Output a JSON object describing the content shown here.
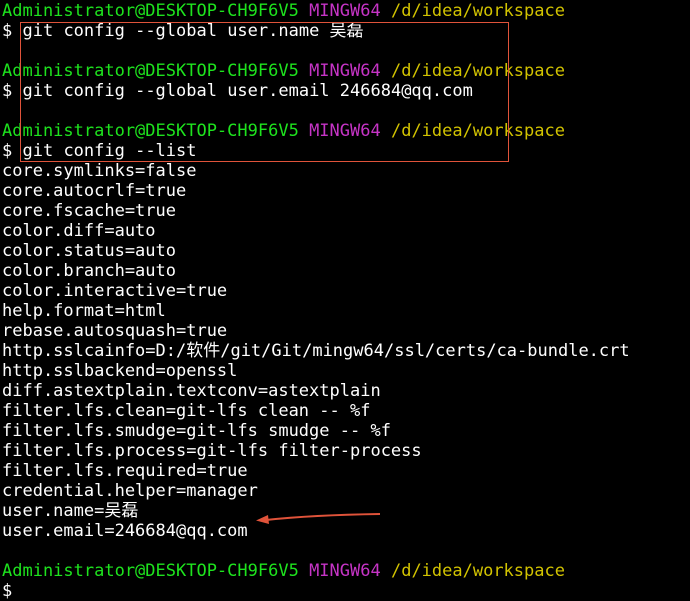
{
  "terminal": {
    "prompt": {
      "user_host": "Administrator@DESKTOP-CH9F6V5",
      "system": "MINGW64",
      "path": "/d/idea/workspace",
      "symbol": "$"
    },
    "commands": [
      "git config --global user.name 吴磊",
      "git config --global user.email 246684@qq.com",
      "git config --list"
    ],
    "output": [
      "core.symlinks=false",
      "core.autocrlf=true",
      "core.fscache=true",
      "color.diff=auto",
      "color.status=auto",
      "color.branch=auto",
      "color.interactive=true",
      "help.format=html",
      "rebase.autosquash=true",
      "http.sslcainfo=D:/软件/git/Git/mingw64/ssl/certs/ca-bundle.crt",
      "http.sslbackend=openssl",
      "diff.astextplain.textconv=astextplain",
      "filter.lfs.clean=git-lfs clean -- %f",
      "filter.lfs.smudge=git-lfs smudge -- %f",
      "filter.lfs.process=git-lfs filter-process",
      "filter.lfs.required=true",
      "credential.helper=manager",
      "user.name=吴磊",
      "user.email=246684@qq.com"
    ]
  },
  "colors": {
    "background": "#000000",
    "user_host": "#1ee31e",
    "system": "#c634c6",
    "path": "#d2c300",
    "text": "#ffffff",
    "annotation": "#e0533a"
  }
}
